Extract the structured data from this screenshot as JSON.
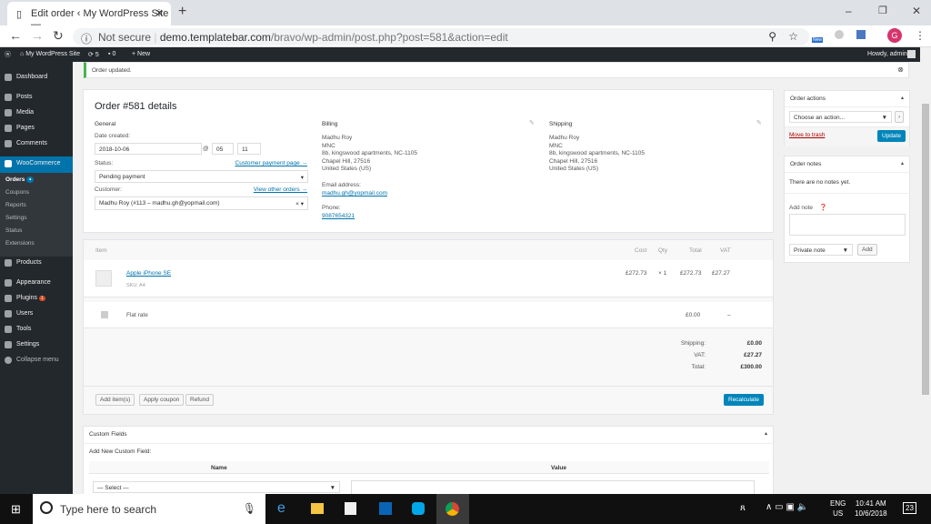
{
  "browser": {
    "tab_title": "Edit order ‹ My WordPress Site —",
    "security": "Not secure",
    "url_host": "demo.templatebar.com",
    "url_path": "/bravo/wp-admin/post.php?post=581&action=edit",
    "profile_initial": "G",
    "ext_badge": "New"
  },
  "adminbar": {
    "site": "My WordPress Site",
    "updates": "5",
    "comments": "0",
    "new": "+ New",
    "howdy": "Howdy, admin"
  },
  "sidebar": {
    "items": [
      "Dashboard",
      "Posts",
      "Media",
      "Pages",
      "Comments",
      "WooCommerce",
      "Products",
      "Appearance",
      "Plugins",
      "Users",
      "Tools",
      "Settings",
      "Collapse menu"
    ],
    "woo_sub": [
      "Orders",
      "Coupons",
      "Reports",
      "Settings",
      "Status",
      "Extensions"
    ],
    "plugins_badge": "1"
  },
  "notice": "Order updated.",
  "order": {
    "title": "Order #581 details",
    "general": "General",
    "date_label": "Date created:",
    "date": "2018-10-06",
    "at": "@",
    "hour": "05",
    "minute": "11",
    "status_label": "Status:",
    "payment_link": "Customer payment page →",
    "status": "Pending payment",
    "customer_label": "Customer:",
    "orders_link": "View other orders →",
    "customer": "Madhu Roy (#113 – madhu.gh@yopmail.com)",
    "billing": {
      "title": "Billing",
      "lines": [
        "Madhu Roy",
        "MNC",
        "8b, kingswood apartments, NC-1105",
        "Chapel Hill, 27516",
        "United States (US)"
      ],
      "email_label": "Email address:",
      "email": "madhu.gh@yopmail.com",
      "phone_label": "Phone:",
      "phone": "9087654321"
    },
    "shipping": {
      "title": "Shipping",
      "lines": [
        "Madhu Roy",
        "MNC",
        "8b, kingswood apartments, NC-1105",
        "Chapel Hill, 27516",
        "United States (US)"
      ]
    }
  },
  "items": {
    "headers": {
      "item": "Item",
      "cost": "Cost",
      "qty": "Qty",
      "total": "Total",
      "vat": "VAT"
    },
    "product": {
      "name": "Apple iPhone SE",
      "sku": "SKU: A4",
      "cost": "£272.73",
      "qty": "× 1",
      "total": "£272.73",
      "vat": "£27.27"
    },
    "shipping": {
      "name": "Flat rate",
      "total": "£0.00",
      "vat": "–"
    },
    "totals": [
      {
        "label": "Shipping:",
        "value": "£0.00"
      },
      {
        "label": "VAT:",
        "value": "£27.27"
      },
      {
        "label": "Total:",
        "value": "£300.00"
      }
    ],
    "buttons": {
      "add": "Add item(s)",
      "coupon": "Apply coupon",
      "refund": "Refund",
      "recalc": "Recalculate"
    }
  },
  "custom_fields": {
    "title": "Custom Fields",
    "add_label": "Add New Custom Field:",
    "name_col": "Name",
    "value_col": "Value",
    "select": "— Select —"
  },
  "order_actions": {
    "title": "Order actions",
    "select": "Choose an action...",
    "trash": "Move to trash",
    "update": "Update"
  },
  "order_notes": {
    "title": "Order notes",
    "empty": "There are no notes yet.",
    "add_label": "Add note",
    "type": "Private note",
    "add": "Add"
  },
  "taskbar": {
    "search": "Type here to search",
    "lang1": "ENG",
    "lang2": "US",
    "time": "10:41 AM",
    "date": "10/6/2018",
    "notif": "23"
  }
}
